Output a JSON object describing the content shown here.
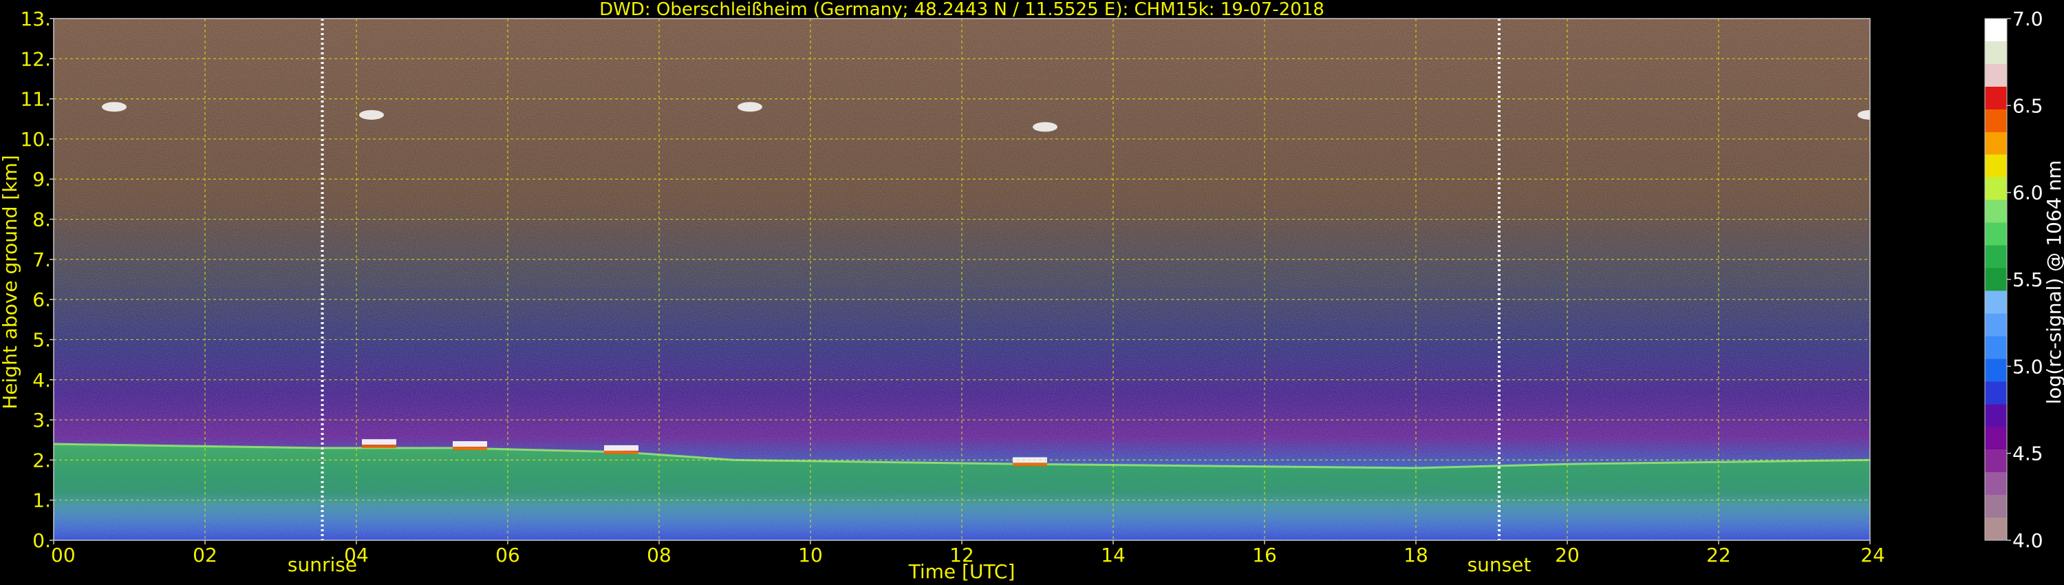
{
  "chart_data": {
    "type": "heatmap",
    "title": "DWD: Oberschleißheim (Germany; 48.2443 N / 11.5525 E):    CHM15k: 19-07-2018",
    "xlabel": "Time [UTC]",
    "ylabel": "Height above ground [km]",
    "colorbar_label": "log(rc-signal) @ 1064 nm",
    "xlim": [
      0,
      24
    ],
    "ylim": [
      0,
      13
    ],
    "x_ticks": [
      0,
      2,
      4,
      6,
      8,
      10,
      12,
      14,
      16,
      18,
      20,
      22,
      24
    ],
    "x_tick_labels": [
      "00",
      "02",
      "04",
      "06",
      "08",
      "10",
      "12",
      "14",
      "16",
      "18",
      "20",
      "22",
      "24"
    ],
    "y_ticks": [
      0,
      1,
      2,
      3,
      4,
      5,
      6,
      7,
      8,
      9,
      10,
      11,
      12,
      13
    ],
    "y_tick_labels": [
      "0.",
      "1.",
      "2.",
      "3.",
      "4.",
      "5.",
      "6.",
      "7.",
      "8.",
      "9.",
      "10.",
      "11.",
      "12.",
      "13."
    ],
    "grid": true,
    "colorbar": {
      "range": [
        4.0,
        7.0
      ],
      "ticks": [
        4.0,
        4.5,
        5.0,
        5.5,
        6.0,
        6.5,
        7.0
      ],
      "tick_labels": [
        "4.0",
        "4.5",
        "5.0",
        "5.5",
        "6.0",
        "6.5",
        "7.0"
      ],
      "colors": [
        "#b09090",
        "#a07898",
        "#9a5aa0",
        "#8a2a9a",
        "#7a0a9a",
        "#5a10a8",
        "#2a3ad8",
        "#1a6af0",
        "#3a8af8",
        "#5aa0fa",
        "#78b8f8",
        "#1a9a3a",
        "#2ab04a",
        "#50d060",
        "#80e070",
        "#c0f040",
        "#f0e000",
        "#f8a000",
        "#f06000",
        "#e01818",
        "#e8c8c8",
        "#e0e8d0",
        "#ffffff"
      ]
    },
    "markers": [
      {
        "label": "sunrise",
        "x": 3.55
      },
      {
        "label": "sunset",
        "x": 19.1
      }
    ],
    "features": [
      {
        "name": "boundary-layer-top",
        "x": [
          0,
          3.5,
          5.3,
          7.5,
          9,
          12.8,
          18,
          20,
          24
        ],
        "y": [
          2.4,
          2.3,
          2.3,
          2.2,
          2.0,
          1.9,
          1.8,
          1.9,
          2.0
        ]
      },
      {
        "name": "cirrus-cloud",
        "x": [
          0.8,
          4.2,
          9.2,
          13.1,
          24
        ],
        "y": [
          10.8,
          10.6,
          10.8,
          10.3,
          10.6
        ]
      },
      {
        "name": "low-cloud-tops",
        "x": [
          4.3,
          5.5,
          7.5,
          12.9
        ],
        "y": [
          2.45,
          2.4,
          2.3,
          2.0
        ]
      }
    ]
  }
}
